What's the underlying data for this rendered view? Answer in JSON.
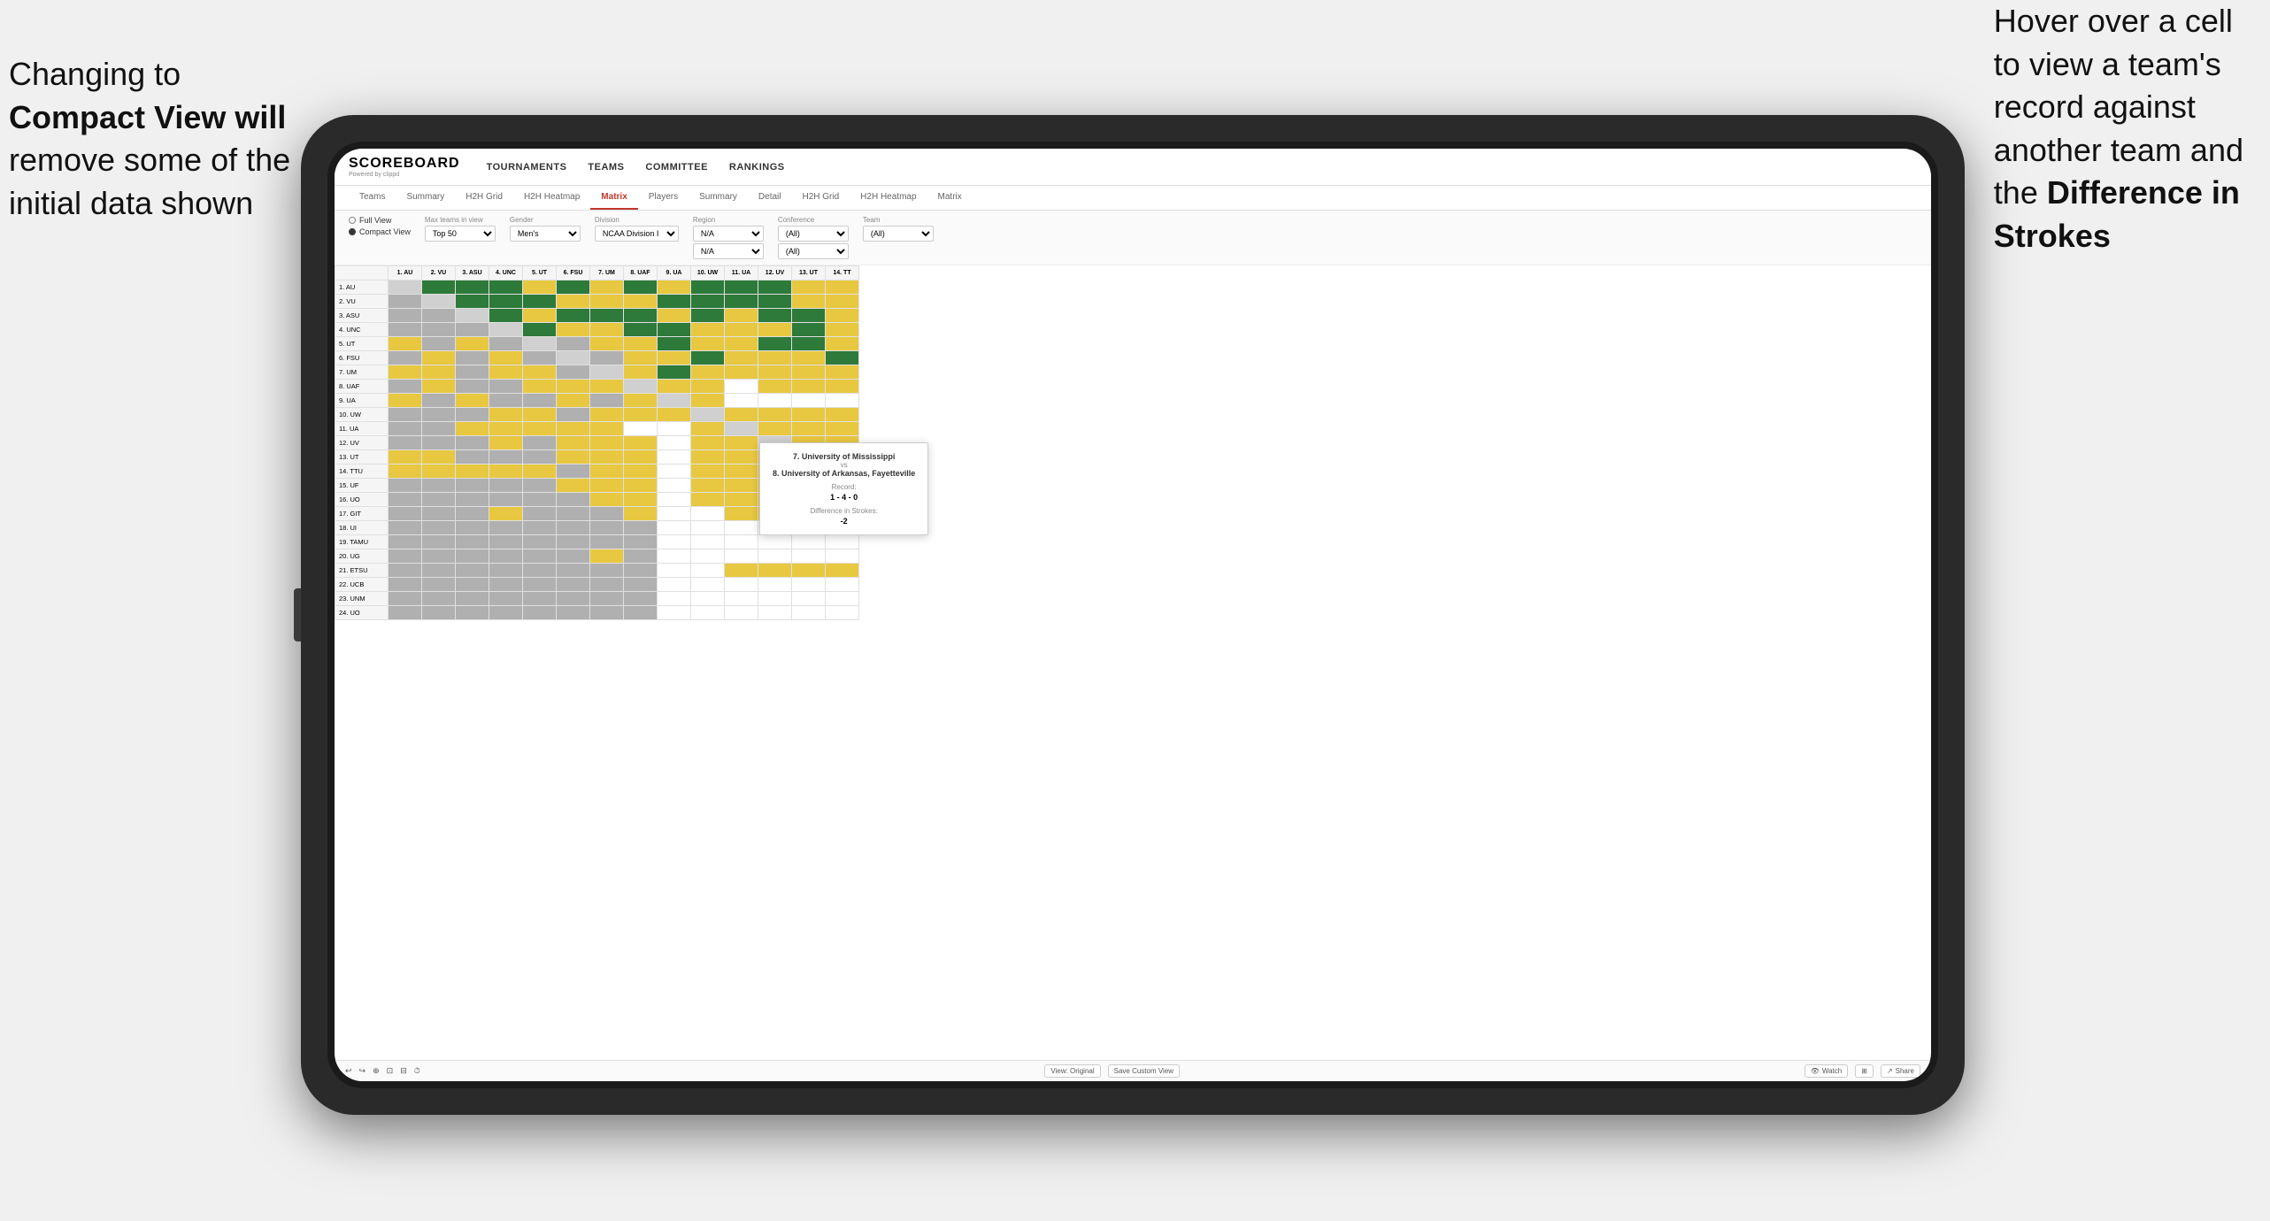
{
  "annotations": {
    "left": {
      "line1": "Changing to",
      "line2": "Compact View will",
      "line3": "remove some of the",
      "line4": "initial data shown"
    },
    "right": {
      "line1": "Hover over a cell",
      "line2": "to view a team's",
      "line3": "record against",
      "line4": "another team and",
      "line5": "the ",
      "line6_bold": "Difference in",
      "line7_bold": "Strokes"
    }
  },
  "app": {
    "logo": "SCOREBOARD",
    "logo_sub": "Powered by clippd",
    "nav": [
      "TOURNAMENTS",
      "TEAMS",
      "COMMITTEE",
      "RANKINGS"
    ],
    "sub_nav": [
      "Teams",
      "Summary",
      "H2H Grid",
      "H2H Heatmap",
      "Matrix",
      "Players",
      "Summary",
      "Detail",
      "H2H Grid",
      "H2H Heatmap",
      "Matrix"
    ],
    "active_tab": "Matrix",
    "filters": {
      "view_options": [
        "Full View",
        "Compact View"
      ],
      "selected_view": "Compact View",
      "max_teams_label": "Max teams in view",
      "max_teams_value": "Top 50",
      "gender_label": "Gender",
      "gender_value": "Men's",
      "division_label": "Division",
      "division_value": "NCAA Division I",
      "region_label": "Region",
      "region_value": "N/A",
      "region_value2": "N/A",
      "conference_label": "Conference",
      "conference_value": "(All)",
      "conference_value2": "(All)",
      "team_label": "Team",
      "team_value": "(All)"
    },
    "col_headers": [
      "1. AU",
      "2. VU",
      "3. ASU",
      "4. UNC",
      "5. UT",
      "6. FSU",
      "7. UM",
      "8. UAF",
      "9. UA",
      "10. UW",
      "11. UA",
      "12. UV",
      "13. UT",
      "14. TT"
    ],
    "rows": [
      {
        "label": "1. AU",
        "cells": [
          "self",
          "green",
          "green",
          "green",
          "yellow",
          "green",
          "yellow",
          "green",
          "yellow",
          "green",
          "green",
          "green",
          "yellow",
          "yellow"
        ]
      },
      {
        "label": "2. VU",
        "cells": [
          "gray",
          "self",
          "green",
          "green",
          "green",
          "yellow",
          "yellow",
          "yellow",
          "green",
          "green",
          "green",
          "green",
          "yellow",
          "yellow"
        ]
      },
      {
        "label": "3. ASU",
        "cells": [
          "gray",
          "gray",
          "self",
          "green",
          "yellow",
          "green",
          "green",
          "green",
          "yellow",
          "green",
          "yellow",
          "green",
          "green",
          "yellow"
        ]
      },
      {
        "label": "4. UNC",
        "cells": [
          "gray",
          "gray",
          "gray",
          "self",
          "green",
          "yellow",
          "yellow",
          "green",
          "green",
          "yellow",
          "yellow",
          "yellow",
          "green",
          "yellow"
        ]
      },
      {
        "label": "5. UT",
        "cells": [
          "yellow",
          "gray",
          "yellow",
          "gray",
          "self",
          "gray",
          "yellow",
          "yellow",
          "green",
          "yellow",
          "yellow",
          "green",
          "green",
          "yellow"
        ]
      },
      {
        "label": "6. FSU",
        "cells": [
          "gray",
          "yellow",
          "gray",
          "yellow",
          "gray",
          "self",
          "gray",
          "yellow",
          "yellow",
          "green",
          "yellow",
          "yellow",
          "yellow",
          "green"
        ]
      },
      {
        "label": "7. UM",
        "cells": [
          "yellow",
          "yellow",
          "gray",
          "yellow",
          "yellow",
          "gray",
          "self",
          "yellow",
          "green",
          "yellow",
          "yellow",
          "yellow",
          "yellow",
          "yellow"
        ]
      },
      {
        "label": "8. UAF",
        "cells": [
          "gray",
          "yellow",
          "gray",
          "gray",
          "yellow",
          "yellow",
          "yellow",
          "self",
          "yellow",
          "yellow",
          "white",
          "yellow",
          "yellow",
          "yellow"
        ]
      },
      {
        "label": "9. UA",
        "cells": [
          "yellow",
          "gray",
          "yellow",
          "gray",
          "gray",
          "yellow",
          "gray",
          "yellow",
          "self",
          "yellow",
          "white",
          "white",
          "white",
          "white"
        ]
      },
      {
        "label": "10. UW",
        "cells": [
          "gray",
          "gray",
          "gray",
          "yellow",
          "yellow",
          "gray",
          "yellow",
          "yellow",
          "yellow",
          "self",
          "yellow",
          "yellow",
          "yellow",
          "yellow"
        ]
      },
      {
        "label": "11. UA",
        "cells": [
          "gray",
          "gray",
          "yellow",
          "yellow",
          "yellow",
          "yellow",
          "yellow",
          "white",
          "white",
          "yellow",
          "self",
          "yellow",
          "yellow",
          "yellow"
        ]
      },
      {
        "label": "12. UV",
        "cells": [
          "gray",
          "gray",
          "gray",
          "yellow",
          "gray",
          "yellow",
          "yellow",
          "yellow",
          "white",
          "yellow",
          "yellow",
          "self",
          "yellow",
          "yellow"
        ]
      },
      {
        "label": "13. UT",
        "cells": [
          "yellow",
          "yellow",
          "gray",
          "gray",
          "gray",
          "yellow",
          "yellow",
          "yellow",
          "white",
          "yellow",
          "yellow",
          "yellow",
          "self",
          "yellow"
        ]
      },
      {
        "label": "14. TTU",
        "cells": [
          "yellow",
          "yellow",
          "yellow",
          "yellow",
          "yellow",
          "gray",
          "yellow",
          "yellow",
          "white",
          "yellow",
          "yellow",
          "yellow",
          "yellow",
          "self"
        ]
      },
      {
        "label": "15. UF",
        "cells": [
          "gray",
          "gray",
          "gray",
          "gray",
          "gray",
          "yellow",
          "yellow",
          "yellow",
          "white",
          "yellow",
          "yellow",
          "yellow",
          "yellow",
          "yellow"
        ]
      },
      {
        "label": "16. UO",
        "cells": [
          "gray",
          "gray",
          "gray",
          "gray",
          "gray",
          "gray",
          "yellow",
          "yellow",
          "white",
          "yellow",
          "yellow",
          "yellow",
          "yellow",
          "yellow"
        ]
      },
      {
        "label": "17. GIT",
        "cells": [
          "gray",
          "gray",
          "gray",
          "yellow",
          "gray",
          "gray",
          "gray",
          "yellow",
          "white",
          "white",
          "yellow",
          "yellow",
          "yellow",
          "yellow"
        ]
      },
      {
        "label": "18. UI",
        "cells": [
          "gray",
          "gray",
          "gray",
          "gray",
          "gray",
          "gray",
          "gray",
          "gray",
          "white",
          "white",
          "white",
          "white",
          "white",
          "white"
        ]
      },
      {
        "label": "19. TAMU",
        "cells": [
          "gray",
          "gray",
          "gray",
          "gray",
          "gray",
          "gray",
          "gray",
          "gray",
          "white",
          "white",
          "white",
          "white",
          "white",
          "white"
        ]
      },
      {
        "label": "20. UG",
        "cells": [
          "gray",
          "gray",
          "gray",
          "gray",
          "gray",
          "gray",
          "yellow",
          "gray",
          "white",
          "white",
          "white",
          "white",
          "white",
          "white"
        ]
      },
      {
        "label": "21. ETSU",
        "cells": [
          "gray",
          "gray",
          "gray",
          "gray",
          "gray",
          "gray",
          "gray",
          "gray",
          "white",
          "white",
          "yellow",
          "yellow",
          "yellow",
          "yellow"
        ]
      },
      {
        "label": "22. UCB",
        "cells": [
          "gray",
          "gray",
          "gray",
          "gray",
          "gray",
          "gray",
          "gray",
          "gray",
          "white",
          "white",
          "white",
          "white",
          "white",
          "white"
        ]
      },
      {
        "label": "23. UNM",
        "cells": [
          "gray",
          "gray",
          "gray",
          "gray",
          "gray",
          "gray",
          "gray",
          "gray",
          "white",
          "white",
          "white",
          "white",
          "white",
          "white"
        ]
      },
      {
        "label": "24. UO",
        "cells": [
          "gray",
          "gray",
          "gray",
          "gray",
          "gray",
          "gray",
          "gray",
          "gray",
          "white",
          "white",
          "white",
          "white",
          "white",
          "white"
        ]
      }
    ],
    "tooltip": {
      "team1": "7. University of Mississippi",
      "vs": "vs",
      "team2": "8. University of Arkansas, Fayetteville",
      "record_label": "Record:",
      "record_value": "1 - 4 - 0",
      "strokes_label": "Difference in Strokes:",
      "strokes_value": "-2"
    },
    "toolbar": {
      "undo": "↩",
      "redo": "↪",
      "view_original": "View: Original",
      "save_custom": "Save Custom View",
      "watch": "Watch",
      "share": "Share"
    }
  }
}
